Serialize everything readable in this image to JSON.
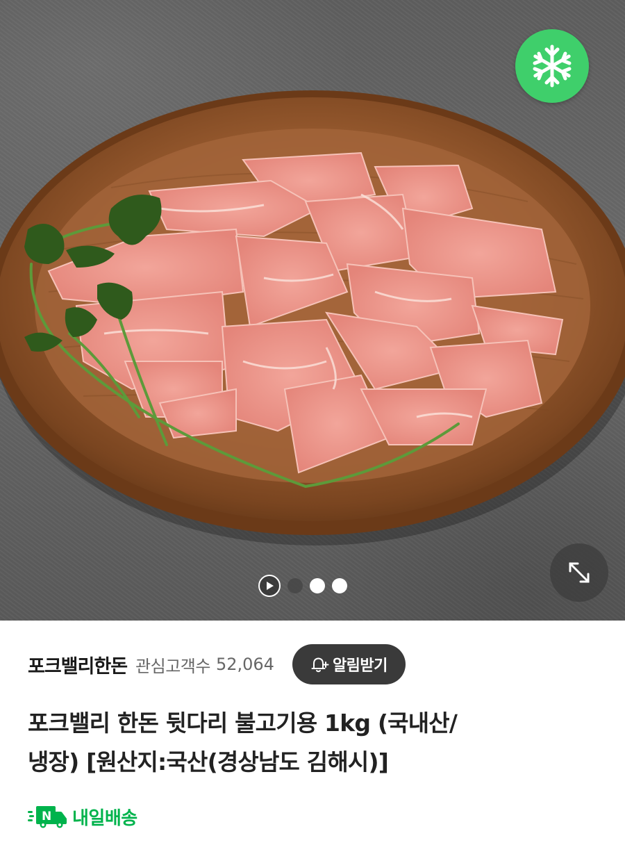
{
  "hero": {
    "badge_icon": "snowflake-icon",
    "badge_color": "#3fcf6b",
    "expand_icon": "expand-arrows-icon",
    "indicator_play_icon": "play-icon",
    "indicator_count": 3,
    "active_indicator": 0
  },
  "store": {
    "name": "포크밸리한돈",
    "interest_label": "관심고객수",
    "interest_count": "52,064",
    "alarm_icon": "bell-plus-icon",
    "alarm_label": "알림받기"
  },
  "product": {
    "title_line1": "포크밸리 한돈 뒷다리 불고기용 1kg (국내산/",
    "title_line2": "냉장) [원산지:국산(경상남도 김해시)]"
  },
  "delivery": {
    "icon": "delivery-truck-n-icon",
    "label": "내일배송",
    "color": "#00b34c"
  }
}
